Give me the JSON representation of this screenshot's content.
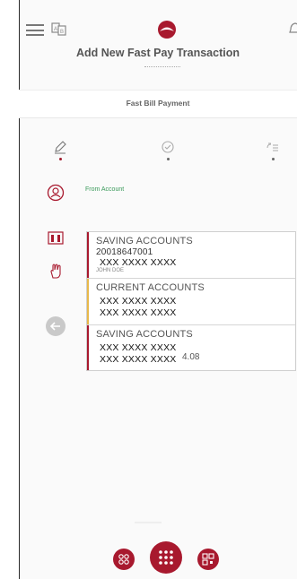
{
  "header": {
    "title": "Add New Fast Pay Transaction",
    "menu_icon": "hamburger-menu-icon",
    "language_icon": "language-switch-icon",
    "logo_icon": "bank-logo-icon",
    "notification_icon": "bell-icon"
  },
  "section": {
    "label": "Fast Bill Payment"
  },
  "steps": [
    {
      "icon": "edit-pencil-icon",
      "active": true
    },
    {
      "icon": "verify-check-icon",
      "active": false
    },
    {
      "icon": "confirm-list-icon",
      "active": false
    }
  ],
  "side_icons": [
    {
      "icon": "user-account-icon"
    },
    {
      "icon": "biller-building-icon"
    },
    {
      "icon": "hand-touch-icon"
    }
  ],
  "form": {
    "from_account_label": "From Account"
  },
  "accounts": [
    {
      "type": "SAVING ACCOUNTS",
      "number": "20018647001",
      "masked": "XXX XXXX XXXX",
      "owner": "JOHN DOE ",
      "bar_color": "#a8192e"
    },
    {
      "type": "CURRENT ACCOUNTS",
      "masked": "XXX XXXX XXXX",
      "masked2": "XXX XXXX XXXX",
      "bar_color": "#e8b84a"
    },
    {
      "type": "SAVING ACCOUNTS",
      "masked": "XXX XXXX XXXX",
      "masked2": "XXX XXXX XXXX",
      "balance": "4.08",
      "bar_color": "#a8192e"
    }
  ],
  "bottom_nav": {
    "left_icon": "apps-icon",
    "center_icon": "grid-menu-icon",
    "right_icon": "qr-code-icon"
  },
  "colors": {
    "brand": "#a8192e",
    "accent_green": "#3a9a5a",
    "accent_yellow": "#e8b84a"
  }
}
